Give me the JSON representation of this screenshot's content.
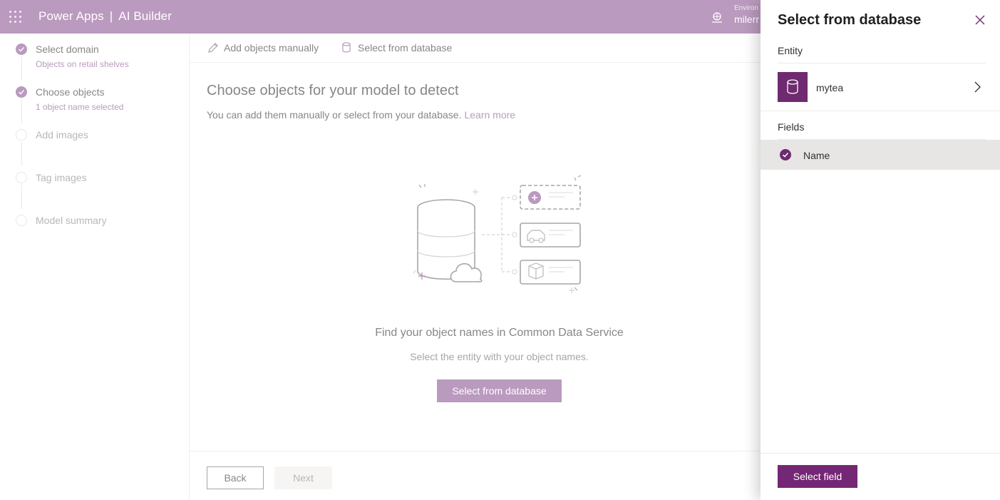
{
  "header": {
    "app_name": "Power Apps",
    "separator": "|",
    "product": "AI Builder",
    "environment_label": "Environ",
    "environment_value": "milerr"
  },
  "steps": [
    {
      "title": "Select domain",
      "subtitle": "Objects on retail shelves",
      "state": "done"
    },
    {
      "title": "Choose objects",
      "subtitle": "1 object name selected",
      "state": "done"
    },
    {
      "title": "Add images",
      "subtitle": "",
      "state": "todo"
    },
    {
      "title": "Tag images",
      "subtitle": "",
      "state": "todo"
    },
    {
      "title": "Model summary",
      "subtitle": "",
      "state": "todo"
    }
  ],
  "command_bar": {
    "add_manual": "Add objects manually",
    "select_db": "Select from database"
  },
  "main": {
    "title": "Choose objects for your model to detect",
    "description": "You can add them manually or select from your database.",
    "learn_more": "Learn more",
    "find_title": "Find your object names in Common Data Service",
    "find_subtitle": "Select the entity with your object names.",
    "select_button": "Select from database"
  },
  "footer": {
    "back": "Back",
    "next": "Next"
  },
  "panel": {
    "title": "Select from database",
    "entity_label": "Entity",
    "entity_name": "mytea",
    "fields_label": "Fields",
    "field_name": "Name",
    "field_selected": true,
    "select_button": "Select field"
  },
  "colors": {
    "header_bg": "#a379a9",
    "accent": "#742774",
    "accent_dim": "#a379a9"
  }
}
